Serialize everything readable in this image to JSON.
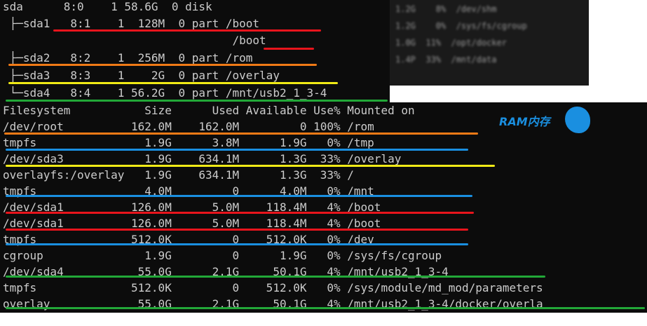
{
  "lsblk": {
    "rows": [
      "sda      8:0    1 58.6G  0 disk",
      " ├─sda1   8:1    1  128M  0 part /boot",
      "                                  /boot",
      " ├─sda2   8:2    1  256M  0 part /rom",
      " ├─sda3   8:3    1    2G  0 part /overlay",
      " └─sda4   8:4    1 56.2G  0 part /mnt/usb2_1_3-4"
    ],
    "blurred_rows": [
      "1.2G    8%  /dev/shm",
      "1.2G    0%  /sys/fs/cgroup",
      "1.0G  11%  /opt/docker",
      "1.4P  33%  /mnt/data"
    ]
  },
  "df": {
    "header": "Filesystem           Size      Used Available Use% Mounted on",
    "rows": [
      "/dev/root          162.0M    162.0M         0 100% /rom",
      "tmpfs                1.9G      3.8M      1.9G   0% /tmp",
      "/dev/sda3            1.9G    634.1M      1.3G  33% /overlay",
      "overlayfs:/overlay   1.9G    634.1M      1.3G  33% /",
      "tmpfs                4.0M         0      4.0M   0% /mnt",
      "/dev/sda1          126.0M      5.0M    118.4M   4% /boot",
      "/dev/sda1          126.0M      5.0M    118.4M   4% /boot",
      "tmpfs              512.0K         0    512.0K   0% /dev",
      "cgroup               1.9G         0      1.9G   0% /sys/fs/cgroup",
      "/dev/sda4           55.0G      2.1G     50.1G   4% /mnt/usb2_1_3-4",
      "tmpfs              512.0K         0    512.0K   0% /sys/module/md_mod/parameters",
      "overlay             55.0G      2.1G     50.1G   4% /mnt/usb2_1_3-4/docker/overla"
    ]
  },
  "annotation": {
    "ram_label": "RAM内存"
  },
  "colors": {
    "red": "#e8141c",
    "orange": "#f07a16",
    "yellow": "#f0ea16",
    "blue": "#1a8fe0",
    "green": "#22a838"
  }
}
